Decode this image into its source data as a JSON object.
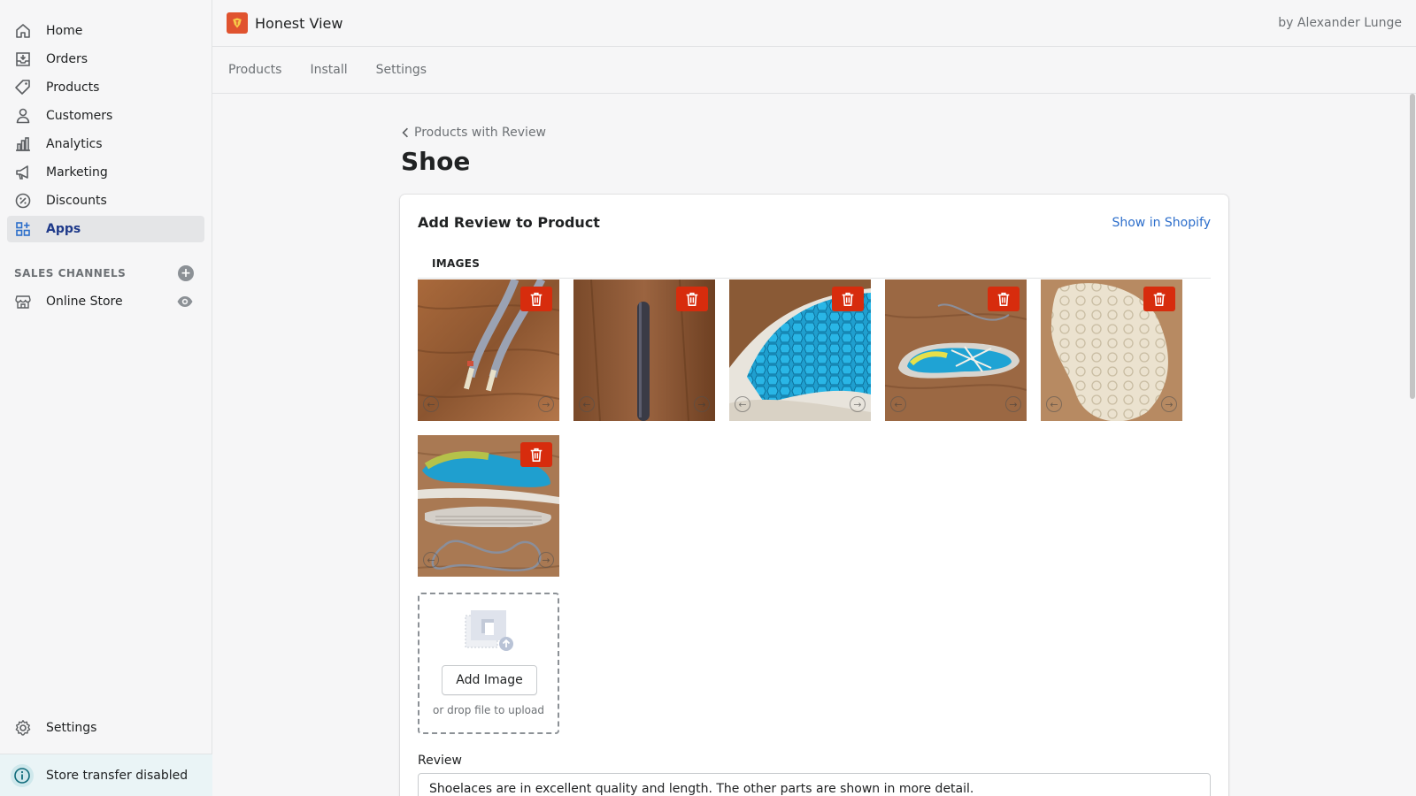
{
  "sidebar": {
    "items": [
      {
        "label": "Home",
        "icon": "home-icon"
      },
      {
        "label": "Orders",
        "icon": "orders-icon"
      },
      {
        "label": "Products",
        "icon": "tag-icon"
      },
      {
        "label": "Customers",
        "icon": "person-icon"
      },
      {
        "label": "Analytics",
        "icon": "bar-chart-icon"
      },
      {
        "label": "Marketing",
        "icon": "megaphone-icon"
      },
      {
        "label": "Discounts",
        "icon": "discount-icon"
      },
      {
        "label": "Apps",
        "icon": "apps-icon",
        "active": true
      }
    ],
    "sales_channels_label": "SALES CHANNELS",
    "online_store_label": "Online Store",
    "settings_label": "Settings",
    "transfer_label": "Store transfer disabled"
  },
  "topbar": {
    "app_title": "Honest View",
    "byline": "by Alexander Lunge"
  },
  "subnav": {
    "tabs": [
      "Products",
      "Install",
      "Settings"
    ]
  },
  "page": {
    "breadcrumb": "Products with Review",
    "title": "Shoe"
  },
  "card": {
    "title": "Add Review to Product",
    "link": "Show in Shopify",
    "images_heading": "IMAGES",
    "add_image_label": "Add Image",
    "drop_hint": "or drop file to upload",
    "review_label": "Review",
    "review_value": "Shoelaces are in excellent quality and length. The other parts are shown in more detail."
  },
  "colors": {
    "accent": "#2c6ecb",
    "danger": "#d72c0d",
    "brand": "#e0532f"
  }
}
